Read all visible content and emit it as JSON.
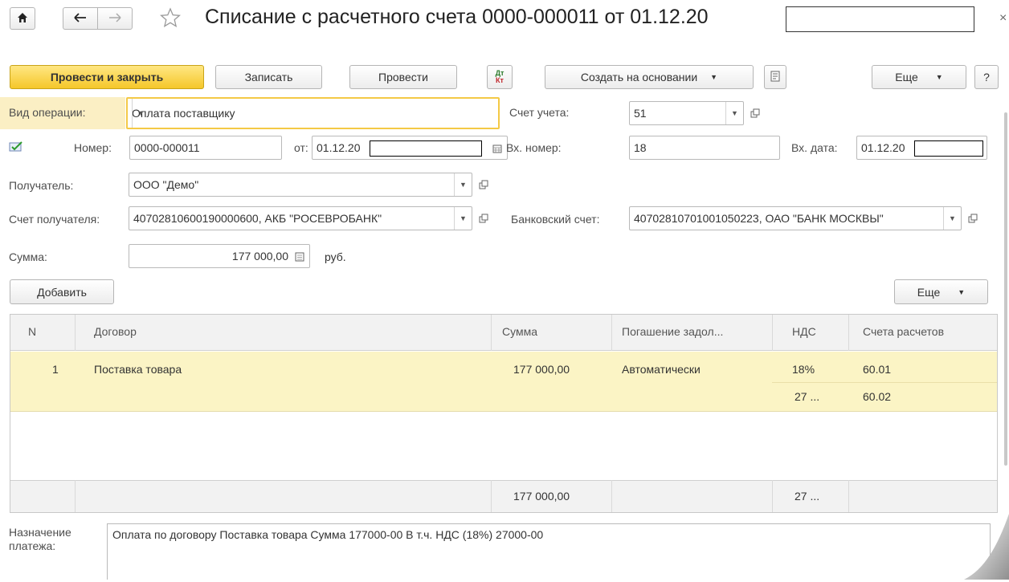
{
  "title": "Списание с расчетного счета 0000-000011 от 01.12.20",
  "toolbar": {
    "post_close": "Провести и закрыть",
    "save": "Записать",
    "post": "Провести",
    "dt_label": "Дт",
    "kt_label": "Кт",
    "create_based": "Создать на основании",
    "more": "Еще",
    "help": "?"
  },
  "form": {
    "operation_label": "Вид операции:",
    "operation_value": "Оплата поставщику",
    "account_label": "Счет учета:",
    "account_value": "51",
    "number_label": "Номер:",
    "number_value": "0000-000011",
    "date_label": "от:",
    "date_value": "01.12.20",
    "in_number_label": "Вх. номер:",
    "in_number_value": "18",
    "in_date_label": "Вх. дата:",
    "in_date_value": "01.12.20",
    "recipient_label": "Получатель:",
    "recipient_value": "ООО \"Демо\"",
    "recipient_account_label": "Счет получателя:",
    "recipient_account_value": "40702810600190000600, АКБ \"РОСЕВРОБАНК\"",
    "bank_account_label": "Банковский счет:",
    "bank_account_value": "40702810701001050223, ОАО \"БАНК МОСКВЫ\"",
    "sum_label": "Сумма:",
    "sum_value": "177 000,00",
    "currency": "руб."
  },
  "table_toolbar": {
    "add": "Добавить",
    "more": "Еще"
  },
  "table": {
    "columns": [
      "N",
      "Договор",
      "Сумма",
      "Погашение задол...",
      "НДС",
      "Счета расчетов"
    ],
    "rows": [
      {
        "n": "1",
        "contract": "Поставка товара",
        "sum": "177 000,00",
        "repayment": "Автоматически",
        "vat_rate": "18%",
        "vat_sum": "27 ...",
        "account1": "60.01",
        "account2": "60.02"
      }
    ],
    "footer": {
      "sum": "177 000,00",
      "vat": "27 ..."
    }
  },
  "purpose": {
    "label_line1": "Назначение",
    "label_line2": "платежа:",
    "value": "Оплата по договору Поставка товара Сумма 177000-00 В т.ч. НДС  (18%) 27000-00"
  },
  "colors": {
    "accent_yellow": "#f5c72a",
    "row_highlight": "#fbf4c5",
    "header_gray": "#f2f2f2"
  }
}
